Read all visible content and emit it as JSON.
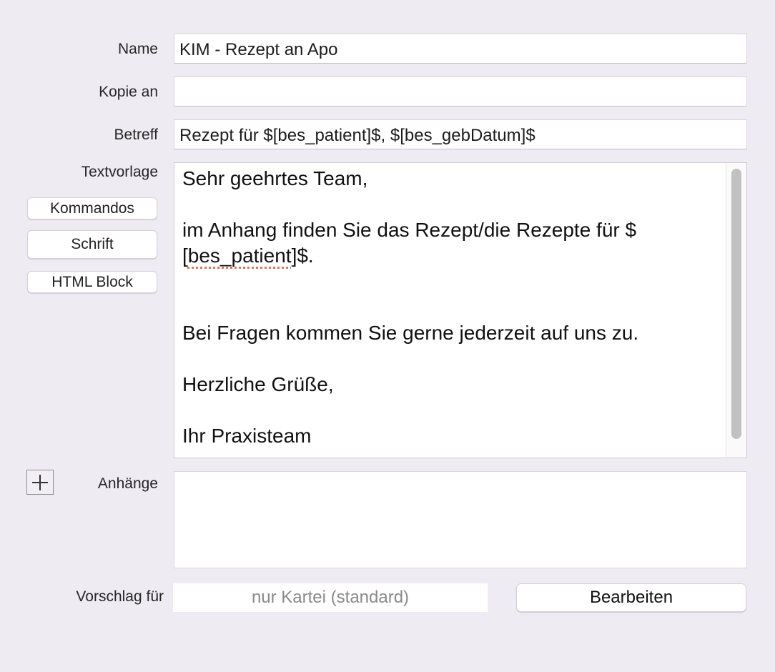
{
  "form": {
    "name_label": "Name",
    "name_value": "KIM - Rezept an Apo",
    "copy_label": "Kopie an",
    "copy_value": "",
    "subject_label": "Betreff",
    "subject_value": "Rezept für $[bes_patient]$, $[bes_gebDatum]$",
    "template_label": "Textvorlage",
    "attachments_label": "Anhänge",
    "suggest_label": "Vorschlag für",
    "suggest_value": "nur Kartei (standard)"
  },
  "side_buttons": {
    "commands": "Kommandos",
    "font": "Schrift",
    "html_block": "HTML Block"
  },
  "editor": {
    "line1": "Sehr geehrtes Team,",
    "line2": "im Anhang finden Sie das Rezept/die Rezepte für $",
    "line3_pre": "[",
    "line3_word": "bes_patient",
    "line3_post": "]$.",
    "line4": "Bei Fragen kommen Sie gerne jederzeit auf uns zu.",
    "line5": "Herzliche Grüße,",
    "line6": "Ihr Praxisteam"
  },
  "buttons": {
    "edit": "Bearbeiten"
  },
  "icons": {
    "add_attachment": "plus-icon"
  }
}
